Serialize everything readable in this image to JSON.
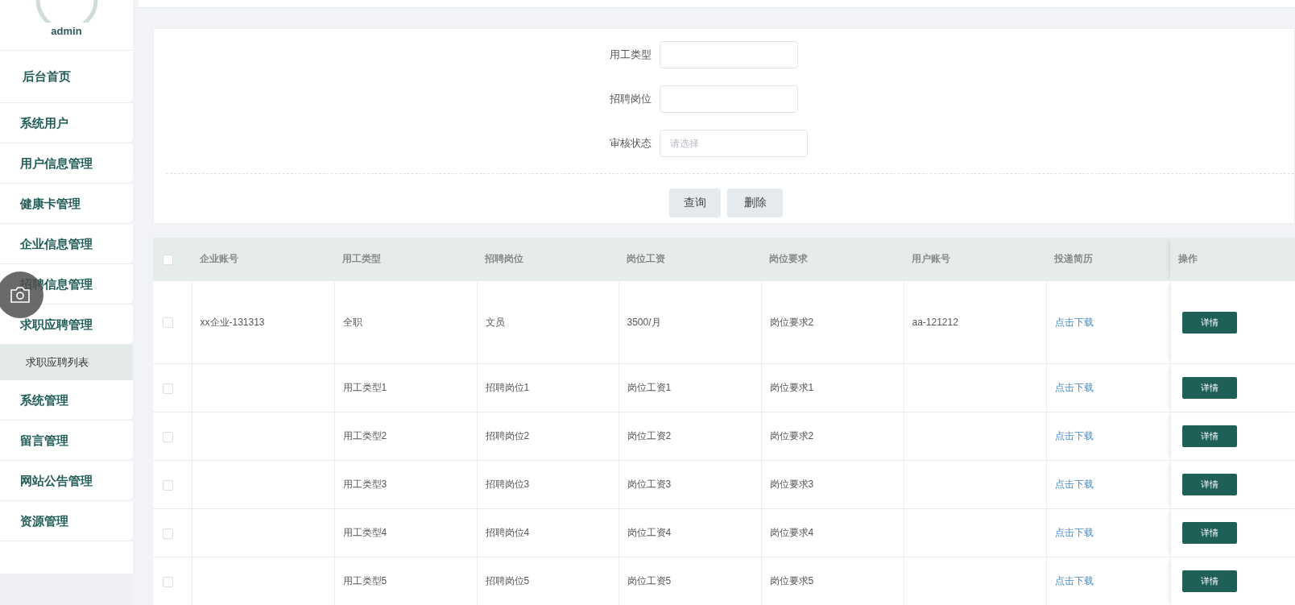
{
  "sidebar": {
    "user": "admin",
    "items": [
      {
        "label": "后台首页"
      },
      {
        "label": "系统用户"
      },
      {
        "label": "用户信息管理"
      },
      {
        "label": "健康卡管理"
      },
      {
        "label": "企业信息管理"
      },
      {
        "label": "招聘信息管理"
      },
      {
        "label": "求职应聘管理",
        "children": [
          {
            "label": "求职应聘列表",
            "selected": true
          }
        ]
      },
      {
        "label": "系统管理"
      },
      {
        "label": "留言管理"
      },
      {
        "label": "网站公告管理"
      },
      {
        "label": "资源管理"
      }
    ]
  },
  "search": {
    "fields": [
      {
        "kind": "text",
        "label": "用工类型"
      },
      {
        "kind": "text",
        "label": "招聘岗位"
      },
      {
        "kind": "select",
        "label": "审核状态",
        "placeholder": "请选择"
      }
    ],
    "buttons": [
      "查询",
      "删除"
    ]
  },
  "table": {
    "all_checked": false,
    "columns": [
      "企业账号",
      "用工类型",
      "招聘岗位",
      "岗位工资",
      "岗位要求",
      "用户账号",
      "投递简历",
      "操作"
    ],
    "rows": [
      {
        "checked": false,
        "cells": [
          "xx企业-131313",
          "全职",
          "文员",
          "3500/月",
          "岗位要求2",
          "aa-121212"
        ],
        "link": "点击下载",
        "action": "详情"
      },
      {
        "checked": false,
        "cells": [
          "",
          "用工类型1",
          "招聘岗位1",
          "岗位工资1",
          "岗位要求1",
          ""
        ],
        "link": "点击下载",
        "action": "详情"
      },
      {
        "checked": false,
        "cells": [
          "",
          "用工类型2",
          "招聘岗位2",
          "岗位工资2",
          "岗位要求2",
          ""
        ],
        "link": "点击下载",
        "action": "详情"
      },
      {
        "checked": false,
        "cells": [
          "",
          "用工类型3",
          "招聘岗位3",
          "岗位工资3",
          "岗位要求3",
          ""
        ],
        "link": "点击下载",
        "action": "详情"
      },
      {
        "checked": false,
        "cells": [
          "",
          "用工类型4",
          "招聘岗位4",
          "岗位工资4",
          "岗位要求4",
          ""
        ],
        "link": "点击下载",
        "action": "详情"
      },
      {
        "checked": false,
        "cells": [
          "",
          "用工类型5",
          "招聘岗位5",
          "岗位工资5",
          "岗位要求5",
          ""
        ],
        "link": "点击下载",
        "action": "详情"
      }
    ]
  }
}
